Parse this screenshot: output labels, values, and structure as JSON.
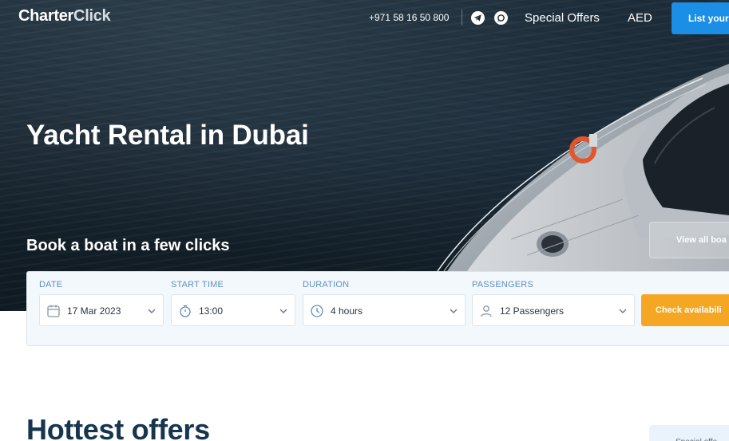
{
  "header": {
    "logo_main": "Charter",
    "logo_accent": "Click",
    "phone": "+971 58 16 50 800",
    "special_offers": "Special Offers",
    "currency": "AED",
    "list_button": "List your"
  },
  "hero": {
    "title": "Yacht Rental in Dubai",
    "subtitle": "Book a boat in a few clicks",
    "view_all": "View all boa"
  },
  "search": {
    "date": {
      "label": "DATE",
      "value": "17 Mar 2023",
      "icon": "calendar-icon"
    },
    "start_time": {
      "label": "START TIME",
      "value": "13:00",
      "icon": "stopwatch-icon"
    },
    "duration": {
      "label": "DURATION",
      "value": "4 hours",
      "icon": "clock-icon"
    },
    "passengers": {
      "label": "PASSENGERS",
      "value": "12 Passengers",
      "icon": "user-icon"
    },
    "check_button": "Check availabili"
  },
  "offers": {
    "title": "Hottest offers",
    "tab": "Special offe"
  },
  "colors": {
    "brand_blue": "#1b8fe6",
    "cta_orange": "#f5a623",
    "heading_navy": "#16354f",
    "label_blue": "#5d8fc0"
  }
}
